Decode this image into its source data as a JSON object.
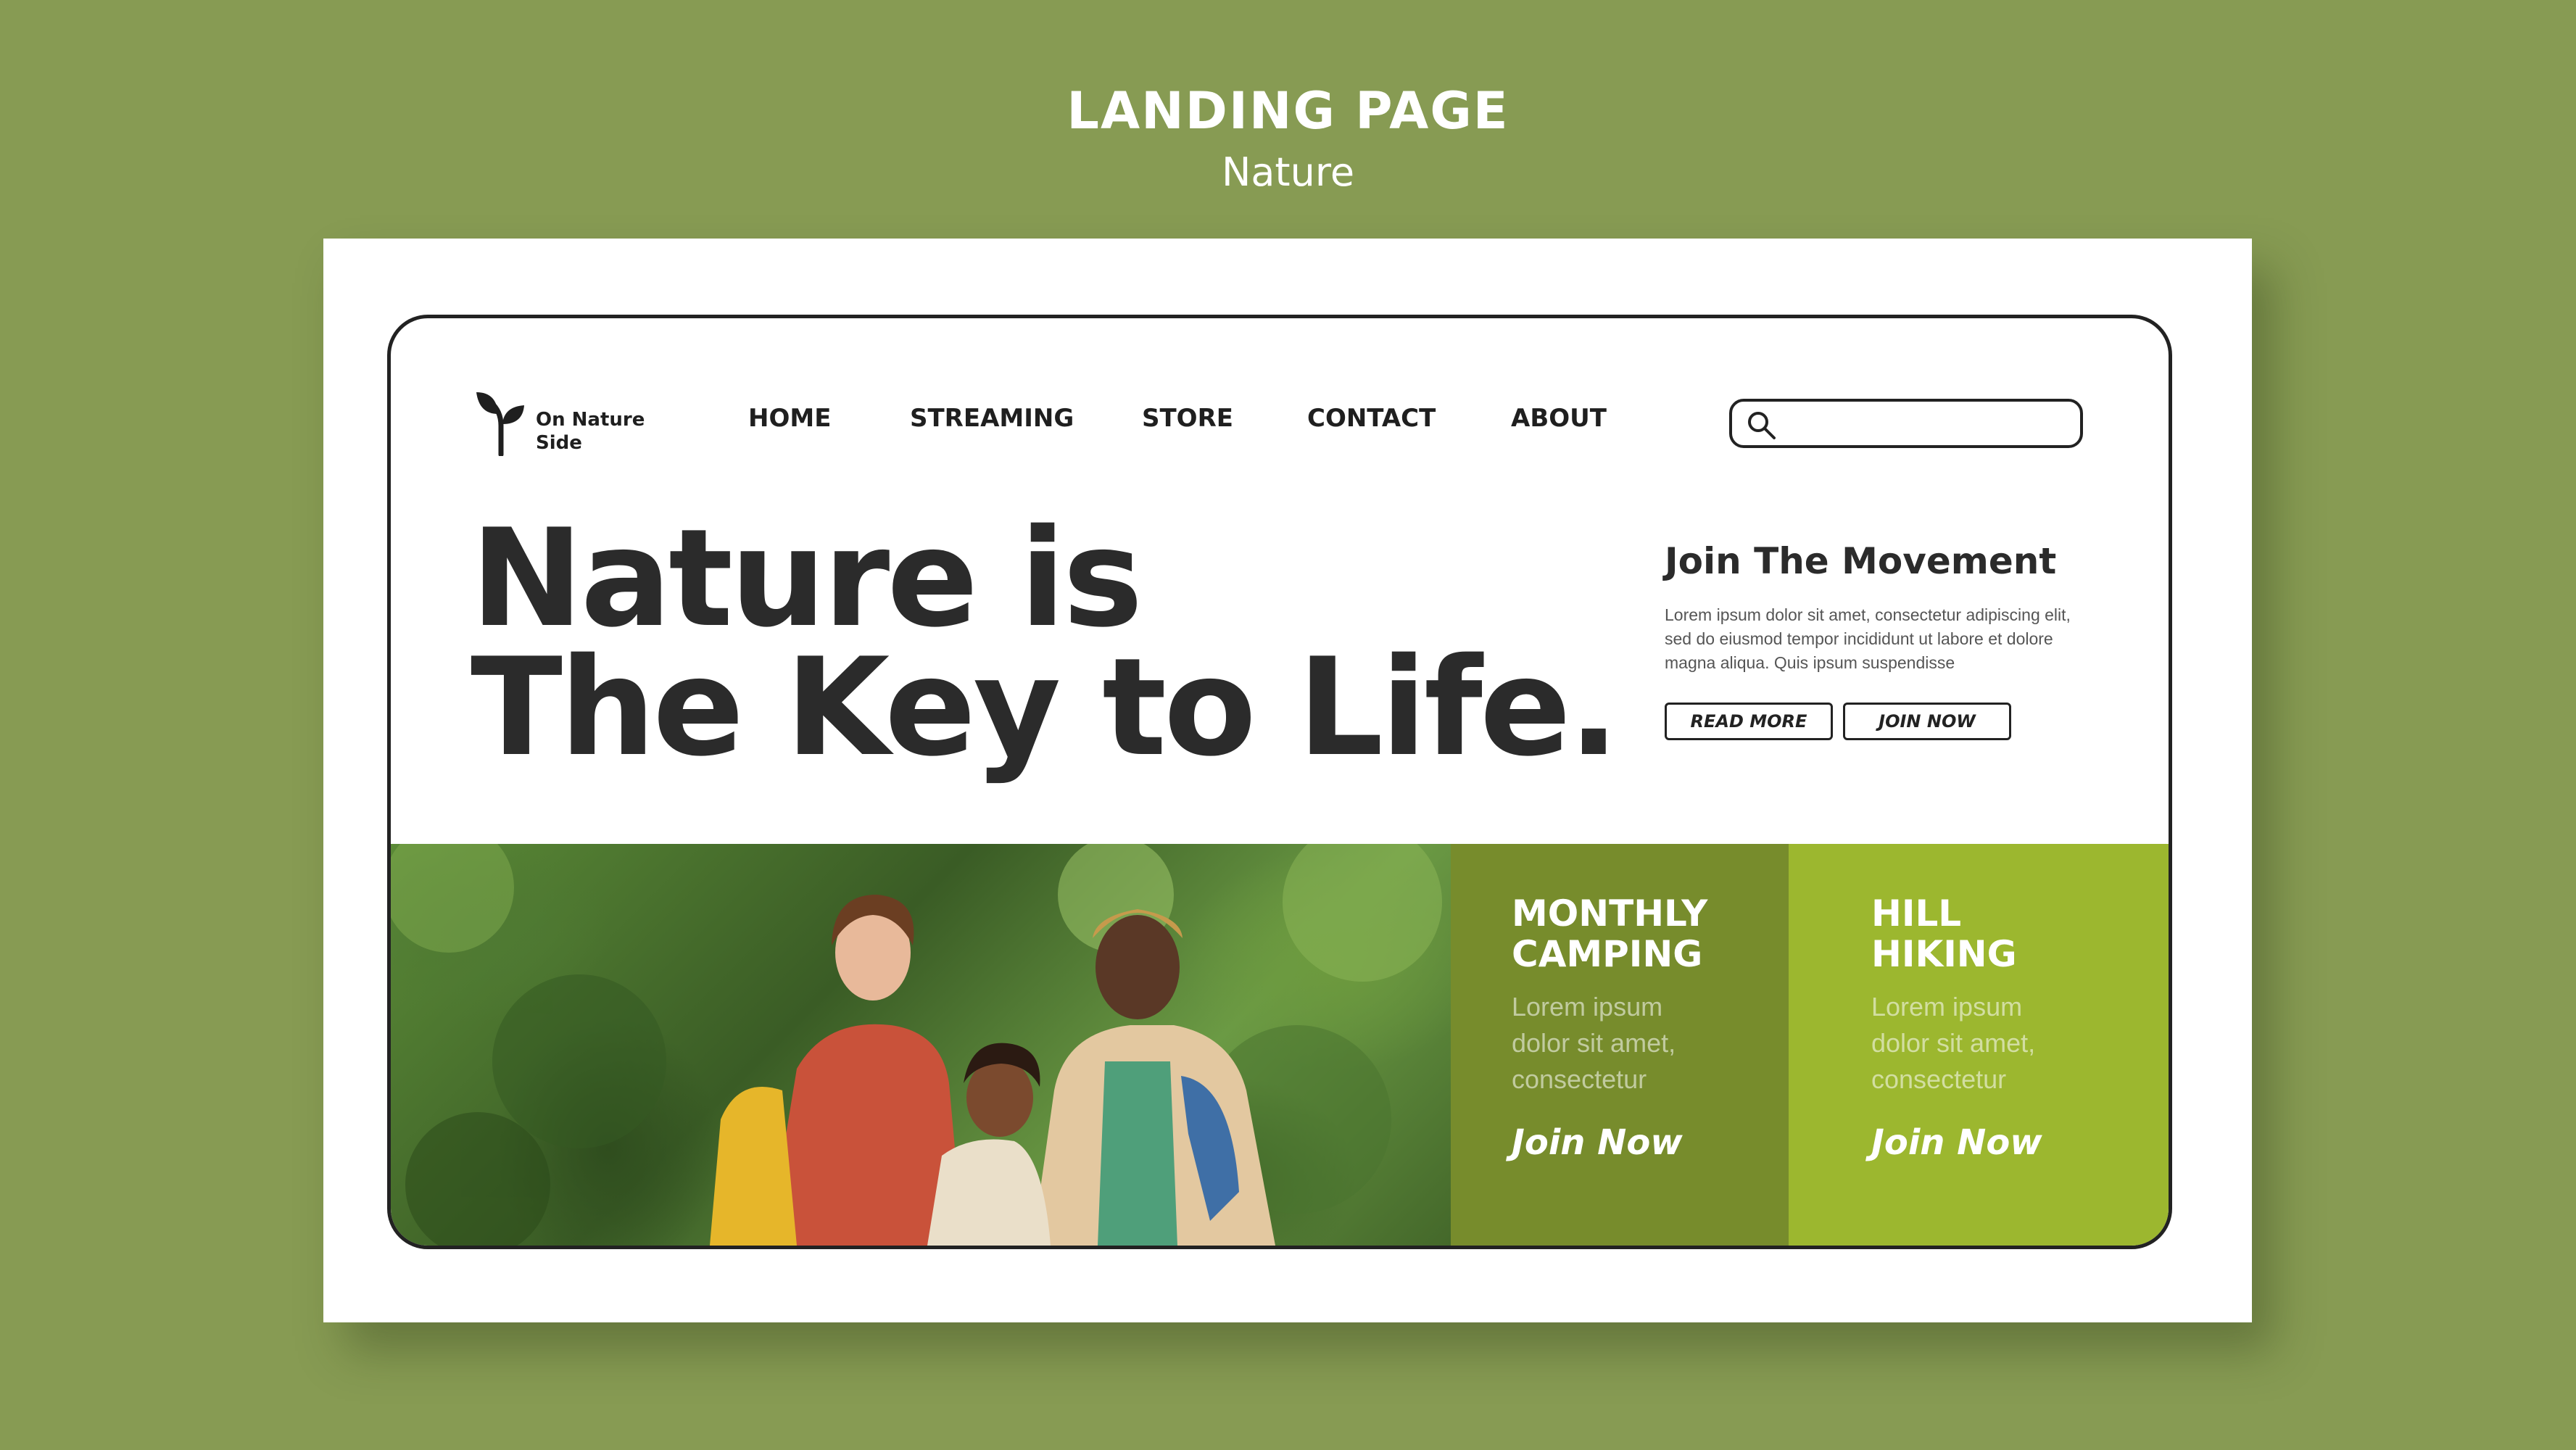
{
  "header": {
    "title": "LANDING PAGE",
    "subtitle": "Nature"
  },
  "brand": {
    "name": "On Nature Side",
    "logo_icon": "sprout-icon"
  },
  "nav": {
    "items": [
      "HOME",
      "STREAMING",
      "STORE",
      "CONTACT",
      "ABOUT"
    ]
  },
  "search": {
    "icon": "search-icon",
    "placeholder": ""
  },
  "hero": {
    "line1": "Nature is",
    "line2": "The Key to Life."
  },
  "join": {
    "title": "Join The Movement",
    "body": "Lorem ipsum dolor sit amet, consectetur adipiscing elit, sed do eiusmod tempor incididunt ut labore et dolore magna aliqua. Quis ipsum suspendisse",
    "read_more": "READ MORE",
    "join_now": "JOIN NOW"
  },
  "cards": [
    {
      "title": "MONTHLY\nCAMPING",
      "body": "Lorem ipsum\ndolor sit amet,\nconsectetur",
      "cta": "Join Now"
    },
    {
      "title": "HILL\nHIKING",
      "body": "Lorem ipsum\ndolor sit amet,\nconsectetur",
      "cta": "Join Now"
    }
  ],
  "colors": {
    "background": "#879b53",
    "card_dark_green": "#778c2c",
    "card_lime": "#9cb72f",
    "text_dark": "#2b2b2b"
  }
}
